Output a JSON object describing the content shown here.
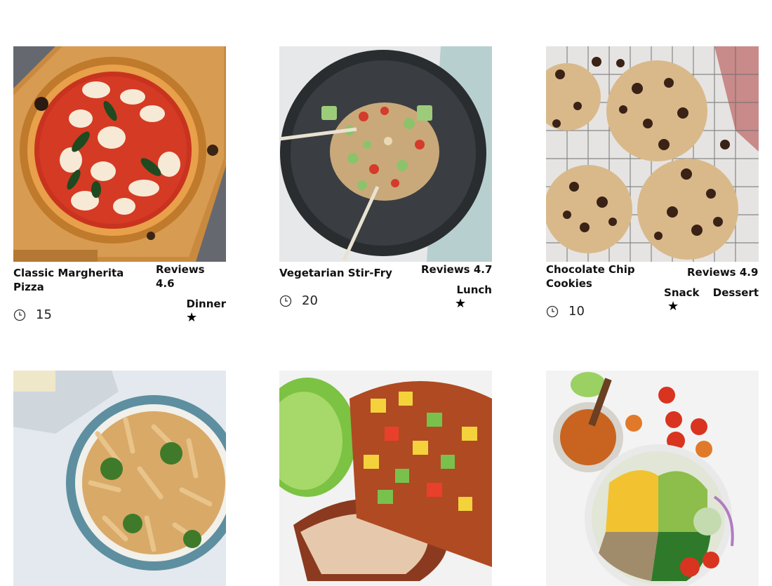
{
  "recipes": [
    {
      "title": "Classic Margherita Pizza",
      "reviews": "Reviews 4.6",
      "time": "15",
      "tags": [
        "Dinner"
      ],
      "star": "★"
    },
    {
      "title": "Vegetarian Stir-Fry",
      "reviews": "Reviews 4.7",
      "time": "20",
      "tags": [
        "Lunch"
      ],
      "star": "★"
    },
    {
      "title": "Chocolate Chip Cookies",
      "reviews": "Reviews 4.9",
      "time": "10",
      "tags": [
        "Snack",
        "Dessert"
      ],
      "star": "★"
    }
  ],
  "icons": {
    "time": "clock-icon",
    "favorite": "star-icon"
  },
  "colors": {
    "text": "#111111",
    "background": "#ffffff"
  }
}
